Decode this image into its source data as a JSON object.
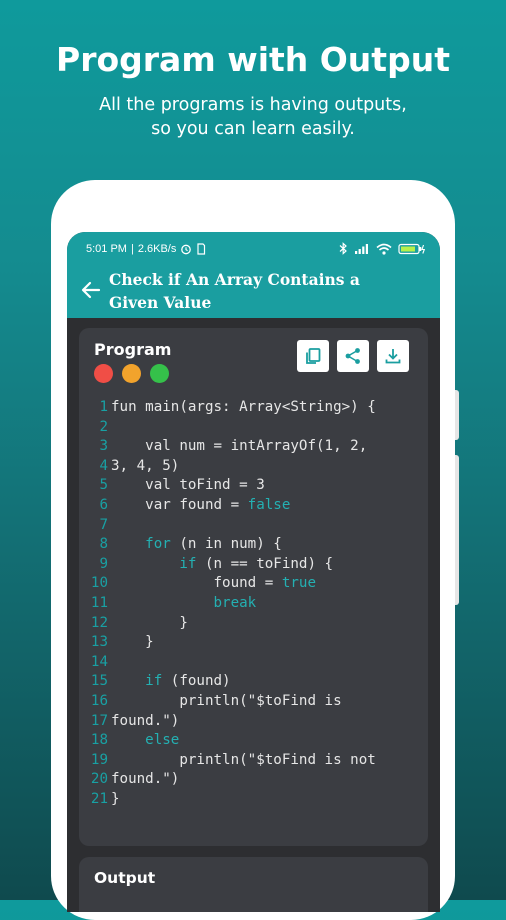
{
  "promo": {
    "title": "Program with Output",
    "subtitle_line1": "All the programs is having outputs,",
    "subtitle_line2": "so you can learn easily."
  },
  "status_bar": {
    "time": "5:01 PM",
    "speed": "2.6KB/s",
    "separator": "|"
  },
  "app_bar": {
    "title_line1": "Check if An Array Contains a",
    "title_line2": "Given Value"
  },
  "program_card": {
    "label": "Program",
    "dot_colors": [
      "#f04e46",
      "#f2a32c",
      "#35c14a"
    ],
    "actions": [
      "copy-icon",
      "share-icon",
      "download-icon"
    ]
  },
  "code_lines": [
    {
      "n": "1",
      "t": "fun main(args: Array<String>) {"
    },
    {
      "n": "2",
      "t": ""
    },
    {
      "n": "3",
      "t": "    val num = intArrayOf(1, 2,"
    },
    {
      "n": "4",
      "t": "3, 4, 5)"
    },
    {
      "n": "5",
      "t": "    val toFind = 3"
    },
    {
      "n": "6",
      "t": "    var found = ",
      "k": "false"
    },
    {
      "n": "7",
      "t": ""
    },
    {
      "n": "8",
      "t": "    ",
      "k": "for",
      "r": " (n in num) {"
    },
    {
      "n": "9",
      "t": "        ",
      "k": "if",
      "r": " (n == toFind) {"
    },
    {
      "n": "10",
      "t": "            found = ",
      "k": "true"
    },
    {
      "n": "11",
      "t": "            ",
      "k": "break"
    },
    {
      "n": "12",
      "t": "        }"
    },
    {
      "n": "13",
      "t": "    }"
    },
    {
      "n": "14",
      "t": ""
    },
    {
      "n": "15",
      "t": "    ",
      "k": "if",
      "r": " (found)"
    },
    {
      "n": "16",
      "t": "        println(\"$toFind is"
    },
    {
      "n": "17",
      "t": "found.\")"
    },
    {
      "n": "18",
      "t": "    ",
      "k": "else"
    },
    {
      "n": "19",
      "t": "        println(\"$toFind is not"
    },
    {
      "n": "20",
      "t": "found.\")"
    },
    {
      "n": "21",
      "t": "}"
    }
  ],
  "output_card": {
    "label": "Output"
  },
  "colors": {
    "accent": "#1a9ea0",
    "code_bg": "#3b3d42",
    "keyword": "#24b0b2"
  }
}
